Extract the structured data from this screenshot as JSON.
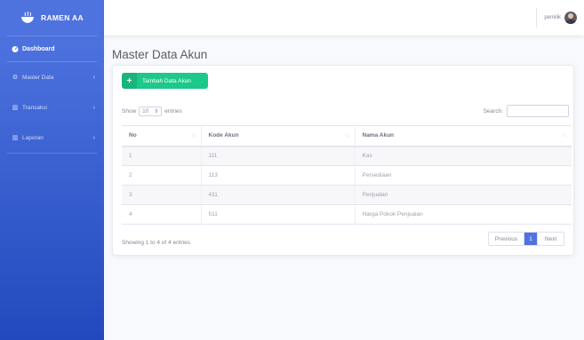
{
  "brand": {
    "name": "RAMEN AA",
    "icon": "ramen-bowl-icon"
  },
  "sidebar": {
    "items": [
      {
        "label": "Dashboard",
        "icon": "dashboard-icon",
        "active": true
      },
      {
        "label": "Master Data",
        "icon": "gear-icon",
        "has_children": true
      },
      {
        "label": "Transaksi",
        "icon": "chart-icon",
        "has_children": true
      },
      {
        "label": "Laporan",
        "icon": "chart-icon",
        "has_children": true
      }
    ]
  },
  "topbar": {
    "username": "pemilik"
  },
  "page": {
    "title": "Master Data Akun"
  },
  "card": {
    "add_button_label": "Tambah Data Akun",
    "length_prefix": "Show",
    "length_value": "10",
    "length_suffix": "entries",
    "search_label": "Search:",
    "search_value": ""
  },
  "table": {
    "headers": [
      "No",
      "Kode Akun",
      "Nama Akun"
    ],
    "rows": [
      [
        "1",
        "111",
        "Kas"
      ],
      [
        "2",
        "113",
        "Persediaan"
      ],
      [
        "3",
        "411",
        "Penjualan"
      ],
      [
        "4",
        "511",
        "Harga Pokok Penjualan"
      ]
    ]
  },
  "footer": {
    "info": "Showing 1 to 4 of 4 entries",
    "prev_label": "Previous",
    "current_page": "1",
    "next_label": "Next"
  },
  "colors": {
    "primary": "#4e73df",
    "success": "#1cc88a",
    "background": "#f8f9fc"
  }
}
